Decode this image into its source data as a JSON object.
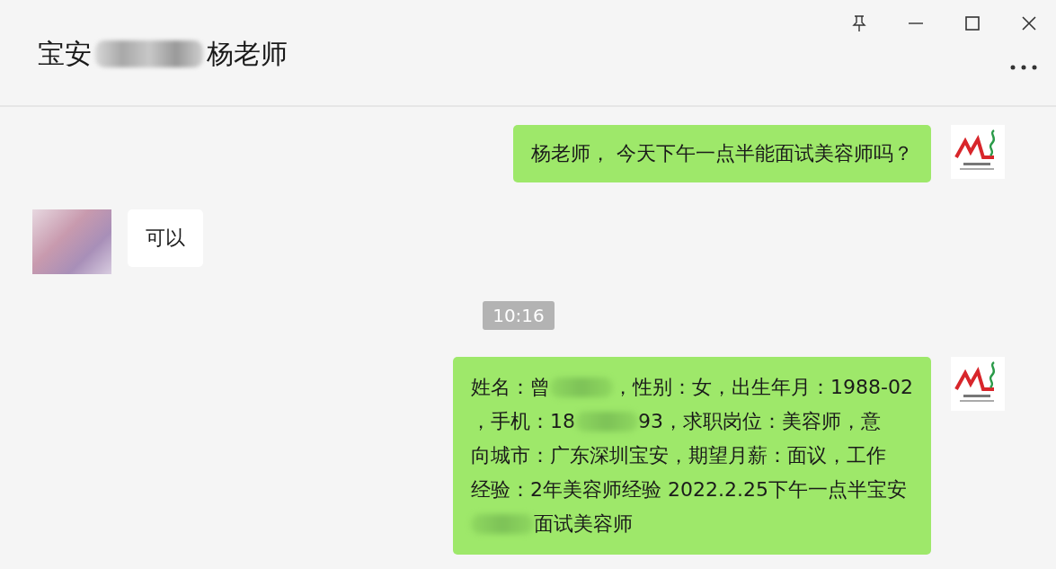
{
  "window": {
    "title": [
      {
        "kind": "text",
        "text": "宝安"
      },
      {
        "kind": "blur"
      },
      {
        "kind": "text",
        "text": "杨老师"
      }
    ]
  },
  "messages": [
    {
      "kind": "sent",
      "lines": [
        [
          {
            "kind": "text",
            "text": "杨老师， 今天下午一点半能面试美容师吗？"
          }
        ]
      ]
    },
    {
      "kind": "received",
      "lines": [
        [
          {
            "kind": "text",
            "text": "可以"
          }
        ]
      ]
    },
    {
      "kind": "time",
      "text": "10:16"
    },
    {
      "kind": "sent",
      "lines": [
        [
          {
            "kind": "text",
            "text": "姓名：曾"
          },
          {
            "kind": "blur"
          },
          {
            "kind": "text",
            "text": "，性别：女，出生年月：1988-02"
          }
        ],
        [
          {
            "kind": "text",
            "text": "，手机：18"
          },
          {
            "kind": "blur"
          },
          {
            "kind": "text",
            "text": "93，求职岗位：美容师，意"
          }
        ],
        [
          {
            "kind": "text",
            "text": "向城市：广东深圳宝安，期望月薪：面议，工作"
          }
        ],
        [
          {
            "kind": "text",
            "text": "经验：2年美容师经验 2022.2.25下午一点半宝安"
          }
        ],
        [
          {
            "kind": "blur"
          },
          {
            "kind": "text",
            "text": "面试美容师"
          }
        ]
      ]
    }
  ]
}
